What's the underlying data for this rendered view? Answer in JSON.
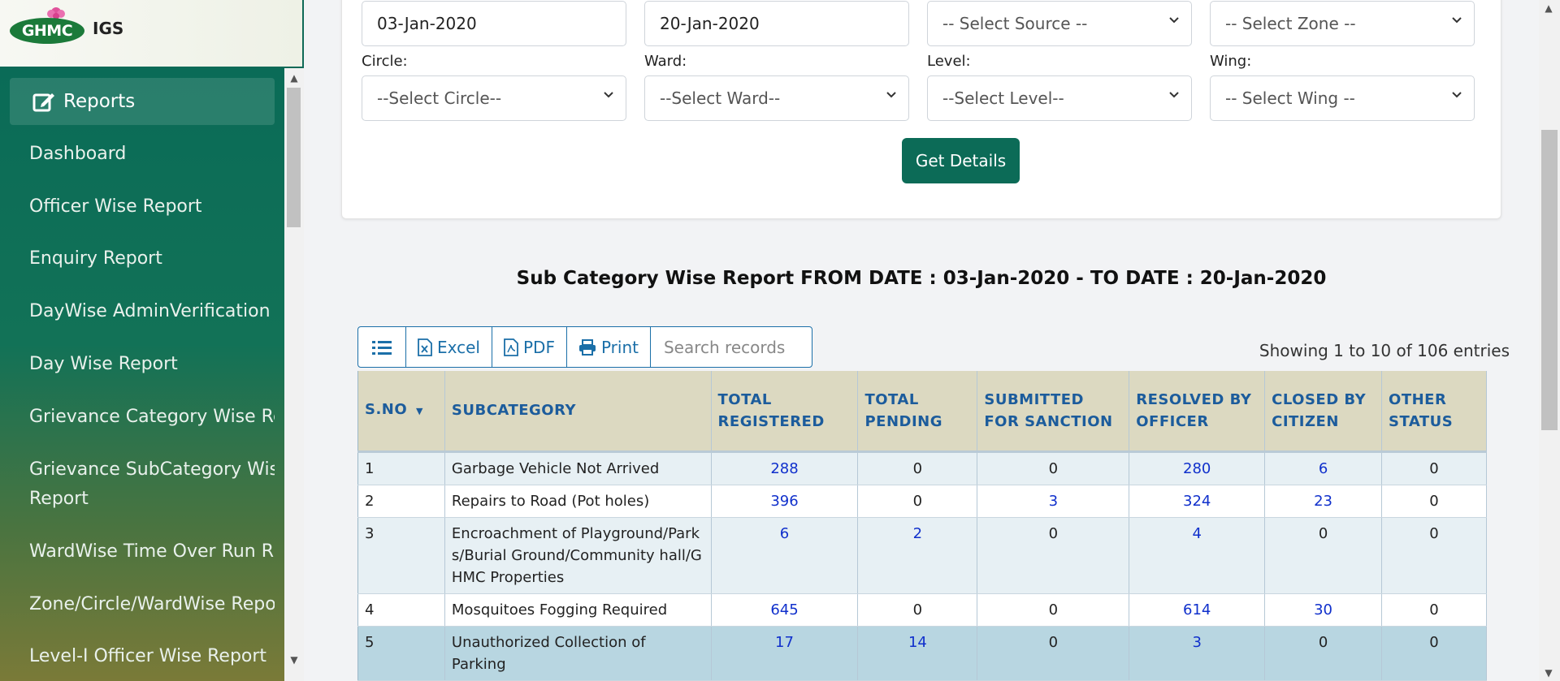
{
  "brand": {
    "logo_text": "GHMC",
    "app_name": "IGS"
  },
  "sidebar": {
    "active": {
      "label": "Reports"
    },
    "items": [
      {
        "label": "Dashboard"
      },
      {
        "label": "Officer Wise Report"
      },
      {
        "label": "Enquiry Report"
      },
      {
        "label": "DayWise AdminVerification"
      },
      {
        "label": "Day Wise Report"
      },
      {
        "label": "Grievance Category Wise Re"
      },
      {
        "label": "Grievance SubCategory Wis"
      },
      {
        "label": "Report"
      },
      {
        "label": "WardWise Time Over Run R"
      },
      {
        "label": "Zone/Circle/WardWise Repo"
      },
      {
        "label": "Level-I Officer Wise Report"
      }
    ]
  },
  "filters": {
    "from_date": "03-Jan-2020",
    "to_date": "20-Jan-2020",
    "source": "-- Select Source --",
    "zone": "-- Select Zone --",
    "circle_label": "Circle:",
    "circle": "--Select Circle--",
    "ward_label": "Ward:",
    "ward": "--Select Ward--",
    "level_label": "Level:",
    "level": "--Select Level--",
    "wing_label": "Wing:",
    "wing": "-- Select Wing --",
    "submit": "Get Details"
  },
  "report": {
    "title": "Sub Category Wise Report FROM DATE : 03-Jan-2020 - TO DATE : 20-Jan-2020",
    "toolbar": {
      "excel": "Excel",
      "pdf": "PDF",
      "print": "Print",
      "search_placeholder": "Search records"
    },
    "showing": "Showing 1 to 10 of 106 entries",
    "columns": [
      "S.NO",
      "SUBCATEGORY",
      "TOTAL REGISTERED",
      "TOTAL PENDING",
      "SUBMITTED FOR SANCTION",
      "RESOLVED BY OFFICER",
      "CLOSED BY CITIZEN",
      "OTHER STATUS"
    ],
    "rows": [
      [
        "1",
        "Garbage Vehicle Not Arrived",
        "288",
        "0",
        "0",
        "280",
        "6",
        "0"
      ],
      [
        "2",
        "Repairs to Road (Pot holes)",
        "396",
        "0",
        "3",
        "324",
        "23",
        "0"
      ],
      [
        "3",
        "Encroachment of Playground/Parks/Burial Ground/Community hall/GHMC Properties",
        "6",
        "2",
        "0",
        "4",
        "0",
        "0"
      ],
      [
        "4",
        "Mosquitoes Fogging Required",
        "645",
        "0",
        "0",
        "614",
        "30",
        "0"
      ],
      [
        "5",
        "Unauthorized Collection of Parking",
        "17",
        "14",
        "0",
        "3",
        "0",
        "0"
      ]
    ]
  }
}
